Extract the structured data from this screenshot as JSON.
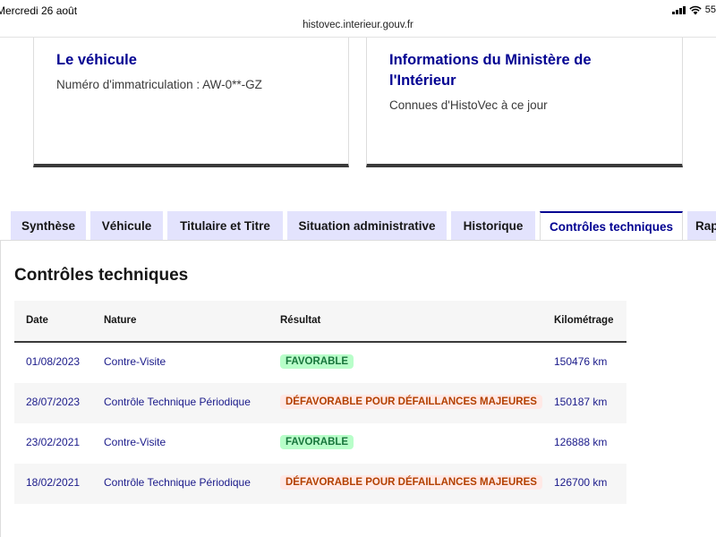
{
  "status": {
    "time": "Mercredi 26 août",
    "battery": "55"
  },
  "browser": {
    "url": "histovec.interieur.gouv.fr"
  },
  "cards": [
    {
      "title": "Le véhicule",
      "text": "Numéro d'immatriculation : AW-0**-GZ"
    },
    {
      "title": "Informations du Ministère de l'Intérieur",
      "text": "Connues d'HistoVec à ce jour"
    }
  ],
  "tabs": [
    {
      "label": "Synthèse"
    },
    {
      "label": "Véhicule"
    },
    {
      "label": "Titulaire et Titre"
    },
    {
      "label": "Situation administrative"
    },
    {
      "label": "Historique"
    },
    {
      "label": "Contrôles techniques"
    },
    {
      "label": "Rap"
    }
  ],
  "active_tab": "Contrôles techniques",
  "section": {
    "title": "Contrôles techniques"
  },
  "table": {
    "headers": {
      "date": "Date",
      "nature": "Nature",
      "result": "Résultat",
      "km": "Kilométrage"
    },
    "rows": [
      {
        "date": "01/08/2023",
        "nature": "Contre-Visite",
        "result": "FAVORABLE",
        "km": "150476 km"
      },
      {
        "date": "28/07/2023",
        "nature": "Contrôle Technique Périodique",
        "result": "DÉFAVORABLE POUR DÉFAILLANCES MAJEURES",
        "km": "150187 km"
      },
      {
        "date": "23/02/2021",
        "nature": "Contre-Visite",
        "result": "FAVORABLE",
        "km": "126888 km"
      },
      {
        "date": "18/02/2021",
        "nature": "Contrôle Technique Périodique",
        "result": "DÉFAVORABLE POUR DÉFAILLANCES MAJEURES",
        "km": "126700 km"
      }
    ]
  },
  "colors": {
    "brand_blue": "#000091",
    "tab_bg": "#e3e3fd",
    "badge_ok_bg": "#b8fec9",
    "badge_ok_text": "#18753c",
    "badge_ko_bg": "#ffe9e6",
    "badge_ko_text": "#b34000"
  }
}
